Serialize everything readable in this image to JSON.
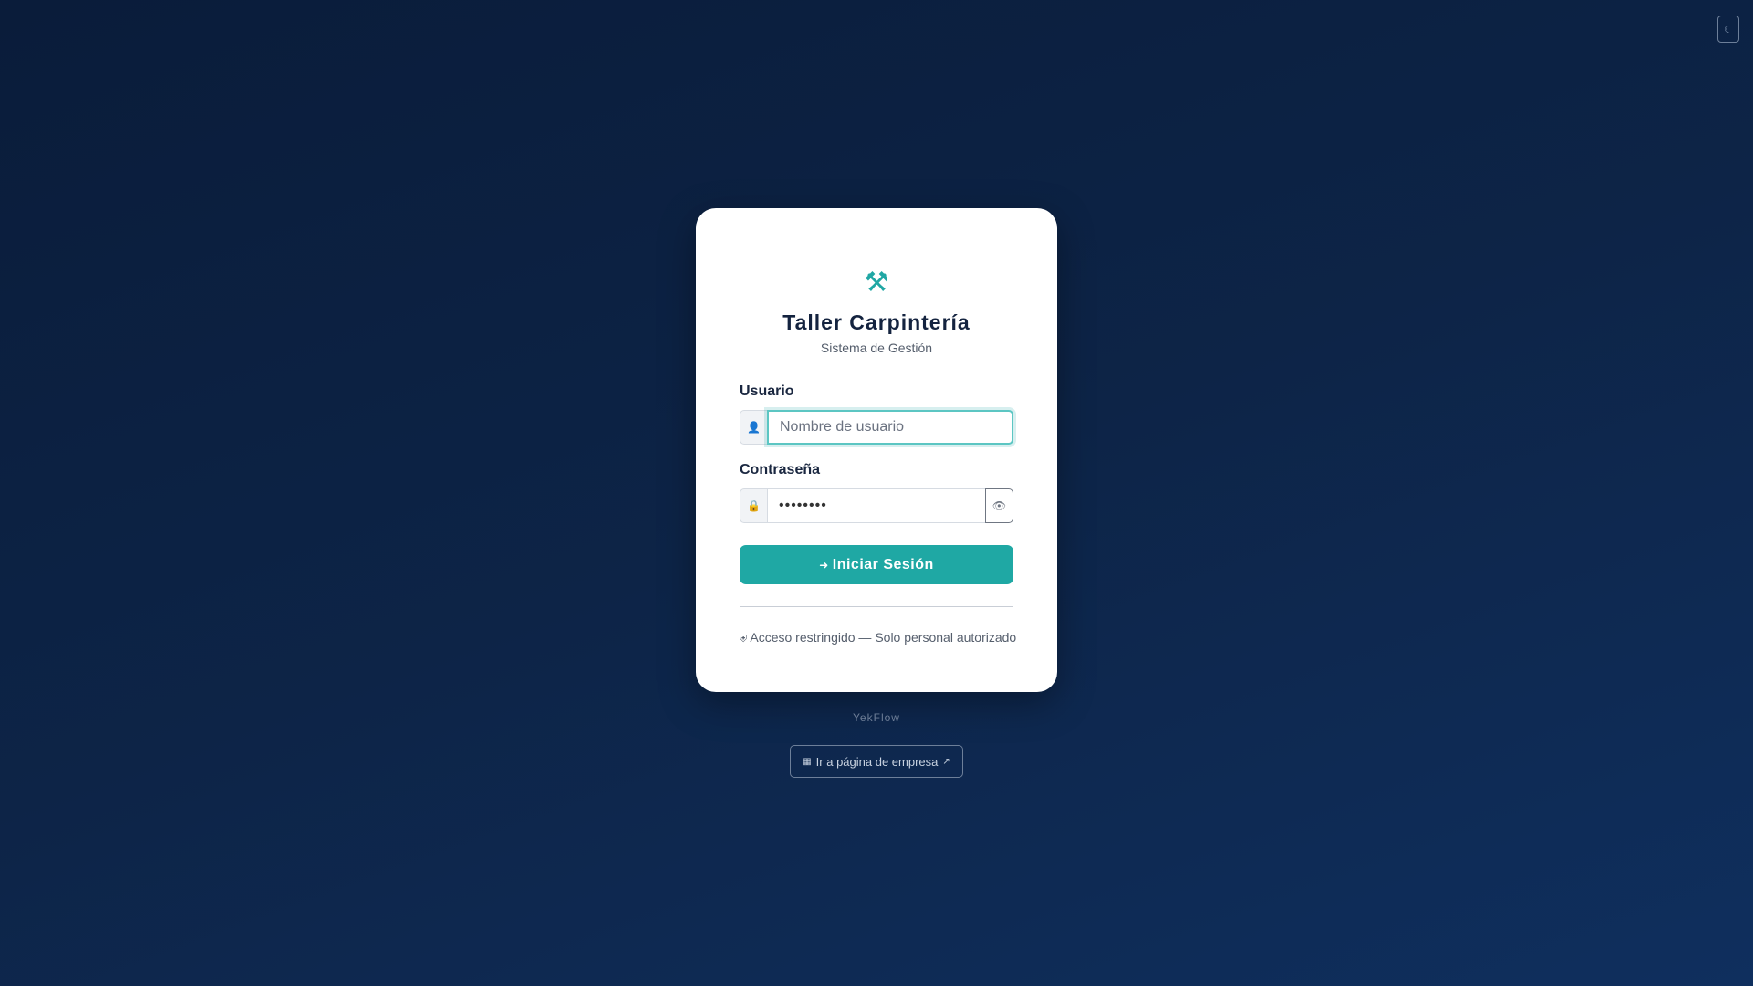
{
  "theme_toggle": {
    "icon": "moon-icon",
    "glyph": "☾"
  },
  "login": {
    "logo_icon": "hammer-icon",
    "logo_glyph": "⚒",
    "title": "Taller Carpintería",
    "subtitle": "Sistema de Gestión",
    "username": {
      "label": "Usuario",
      "placeholder": "Nombre de usuario",
      "value": "",
      "icon": "user-icon",
      "icon_glyph": "👤"
    },
    "password": {
      "label": "Contraseña",
      "value": "••••••••",
      "icon": "lock-icon",
      "icon_glyph": "🔒",
      "toggle_icon": "eye-icon",
      "toggle_glyph": "👁"
    },
    "submit": {
      "label": "Iniciar Sesión",
      "icon": "sign-in-icon",
      "icon_glyph": "➜"
    },
    "notice": {
      "icon": "shield-icon",
      "icon_glyph": "⛨",
      "text": "Acceso restringido — Solo personal autorizado"
    }
  },
  "footer": {
    "brand": "YekFlow",
    "company_link": {
      "label": "Ir a página de empresa",
      "leading_icon": "building-icon",
      "leading_glyph": "▦",
      "trailing_icon": "external-link-icon",
      "trailing_glyph": "↗"
    }
  },
  "colors": {
    "accent": "#1fa8a4",
    "background_top": "#0a1c3a",
    "background_bottom": "#0f2f5e",
    "card": "#ffffff"
  }
}
